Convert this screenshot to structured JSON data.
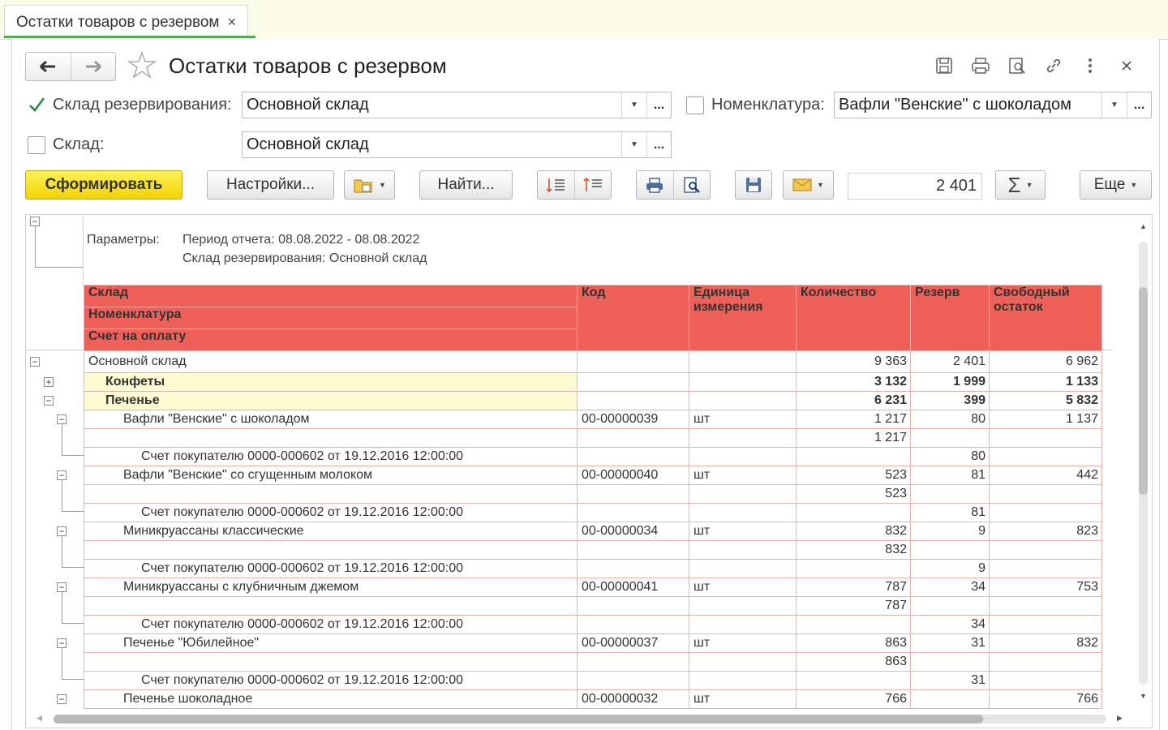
{
  "tab": {
    "label": "Остатки товаров с резервом",
    "close": "×"
  },
  "title": "Остатки товаров с резервом",
  "filters": {
    "reserve_warehouse": {
      "label": "Склад резервирования:",
      "checked": true,
      "value": "Основной склад"
    },
    "nomenclature": {
      "label": "Номенклатура:",
      "checked": false,
      "value": "Вафли \"Венские\" с шоколадом"
    },
    "warehouse": {
      "label": "Склад:",
      "checked": false,
      "value": "Основной склад"
    },
    "more": "..."
  },
  "toolbar": {
    "generate": "Сформировать",
    "settings": "Настройки...",
    "find": "Найти...",
    "sum_value": "2 401",
    "more": "Еще"
  },
  "params": {
    "label": "Параметры:",
    "period": "Период отчета: 08.08.2022 - 08.08.2022",
    "reserve": "Склад резервирования: Основной склад"
  },
  "header": {
    "warehouse": "Склад",
    "nomenclature": "Номенклатура",
    "invoice": "Счет на оплату",
    "code": "Код",
    "unit_1": "Единица",
    "unit_2": "измерения",
    "qty": "Количество",
    "reserve": "Резерв",
    "free_1": "Свободный",
    "free_2": "остаток"
  },
  "rows": [
    {
      "type": "group",
      "name": "Основной склад",
      "code": "",
      "unit": "",
      "qty": "9 363",
      "reserve": "2 401",
      "free": "6 962"
    },
    {
      "type": "sub",
      "name": "Конфеты",
      "code": "",
      "unit": "",
      "qty": "3 132",
      "reserve": "1 999",
      "free": "1 133"
    },
    {
      "type": "sub",
      "name": "Печенье",
      "code": "",
      "unit": "",
      "qty": "6 231",
      "reserve": "399",
      "free": "5 832"
    },
    {
      "type": "item",
      "name": "Вафли \"Венские\" с шоколадом",
      "code": "00-00000039",
      "unit": "шт",
      "qty": "1 217",
      "reserve": "80",
      "free": "1 137"
    },
    {
      "type": "blank",
      "name": "",
      "code": "",
      "unit": "",
      "qty": "1 217",
      "reserve": "",
      "free": ""
    },
    {
      "type": "inv",
      "name": "Счет покупателю 0000-000602 от 19.12.2016 12:00:00",
      "code": "",
      "unit": "",
      "qty": "",
      "reserve": "80",
      "free": ""
    },
    {
      "type": "item",
      "name": "Вафли \"Венские\" со сгущенным молоком",
      "code": "00-00000040",
      "unit": "шт",
      "qty": "523",
      "reserve": "81",
      "free": "442"
    },
    {
      "type": "blank",
      "name": "",
      "code": "",
      "unit": "",
      "qty": "523",
      "reserve": "",
      "free": ""
    },
    {
      "type": "inv",
      "name": "Счет покупателю 0000-000602 от 19.12.2016 12:00:00",
      "code": "",
      "unit": "",
      "qty": "",
      "reserve": "81",
      "free": ""
    },
    {
      "type": "item",
      "name": "Миникруассаны классические",
      "code": "00-00000034",
      "unit": "шт",
      "qty": "832",
      "reserve": "9",
      "free": "823"
    },
    {
      "type": "blank",
      "name": "",
      "code": "",
      "unit": "",
      "qty": "832",
      "reserve": "",
      "free": ""
    },
    {
      "type": "inv",
      "name": "Счет покупателю 0000-000602 от 19.12.2016 12:00:00",
      "code": "",
      "unit": "",
      "qty": "",
      "reserve": "9",
      "free": ""
    },
    {
      "type": "item",
      "name": "Миникруассаны с клубничным джемом",
      "code": "00-00000041",
      "unit": "шт",
      "qty": "787",
      "reserve": "34",
      "free": "753"
    },
    {
      "type": "blank",
      "name": "",
      "code": "",
      "unit": "",
      "qty": "787",
      "reserve": "",
      "free": ""
    },
    {
      "type": "inv",
      "name": "Счет покупателю 0000-000602 от 19.12.2016 12:00:00",
      "code": "",
      "unit": "",
      "qty": "",
      "reserve": "34",
      "free": ""
    },
    {
      "type": "item",
      "name": "Печенье \"Юбилейное\"",
      "code": "00-00000037",
      "unit": "шт",
      "qty": "863",
      "reserve": "31",
      "free": "832"
    },
    {
      "type": "blank",
      "name": "",
      "code": "",
      "unit": "",
      "qty": "863",
      "reserve": "",
      "free": ""
    },
    {
      "type": "inv",
      "name": "Счет покупателю 0000-000602 от 19.12.2016 12:00:00",
      "code": "",
      "unit": "",
      "qty": "",
      "reserve": "31",
      "free": ""
    },
    {
      "type": "item",
      "name": "Печенье шоколадное",
      "code": "00-00000032",
      "unit": "шт",
      "qty": "766",
      "reserve": "",
      "free": "766"
    }
  ],
  "icons": [
    "back-arrow-icon",
    "forward-arrow-icon",
    "star-icon",
    "save-icon",
    "print-icon",
    "preview-icon",
    "link-icon",
    "more-vertical-icon",
    "close-icon",
    "folder-icon",
    "sort-asc-icon",
    "sort-desc-icon",
    "printer-icon",
    "search-doc-icon",
    "floppy-icon",
    "mail-icon",
    "sigma-icon"
  ],
  "colors": {
    "header_bg": "#ee6058",
    "group_bg": "#f7f96a",
    "primary_button": "#f1d400",
    "check": "#2e8b3e",
    "tab_active": "#4caf50"
  }
}
